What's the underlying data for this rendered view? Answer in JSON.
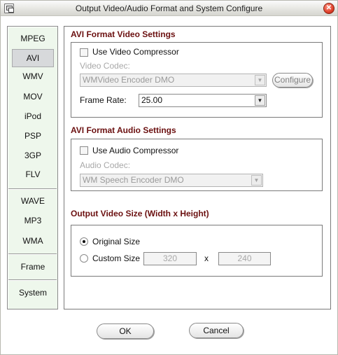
{
  "window": {
    "title": "Output Video/Audio Format and System Configure",
    "close_symbol": "✕"
  },
  "nav": {
    "items": [
      {
        "label": "MPEG"
      },
      {
        "label": "AVI",
        "selected": true
      },
      {
        "label": "WMV"
      },
      {
        "label": "MOV"
      },
      {
        "label": "iPod"
      },
      {
        "label": "PSP"
      },
      {
        "label": "3GP"
      },
      {
        "label": "FLV"
      },
      {
        "label": "WAVE"
      },
      {
        "label": "MP3"
      },
      {
        "label": "WMA"
      },
      {
        "label": "Frame"
      },
      {
        "label": "System"
      }
    ]
  },
  "video_settings": {
    "title": "AVI Format Video Settings",
    "use_compressor_label": "Use Video Compressor",
    "use_compressor_checked": false,
    "codec_label": "Video Codec:",
    "codec_value": "WMVideo Encoder DMO",
    "configure_label": "Configure",
    "frame_rate_label": "Frame Rate:",
    "frame_rate_value": "25.00"
  },
  "audio_settings": {
    "title": "AVI Format Audio Settings",
    "use_compressor_label": "Use Audio Compressor",
    "use_compressor_checked": false,
    "codec_label": "Audio Codec:",
    "codec_value": "WM Speech Encoder DMO"
  },
  "video_size": {
    "title": "Output Video Size (Width x Height)",
    "original_label": "Original Size",
    "original_selected": true,
    "custom_label": "Custom Size",
    "width_value": "320",
    "times": "x",
    "height_value": "240"
  },
  "footer": {
    "ok_label": "OK",
    "cancel_label": "Cancel"
  },
  "icons": {
    "dropdown_arrow": "▼"
  }
}
